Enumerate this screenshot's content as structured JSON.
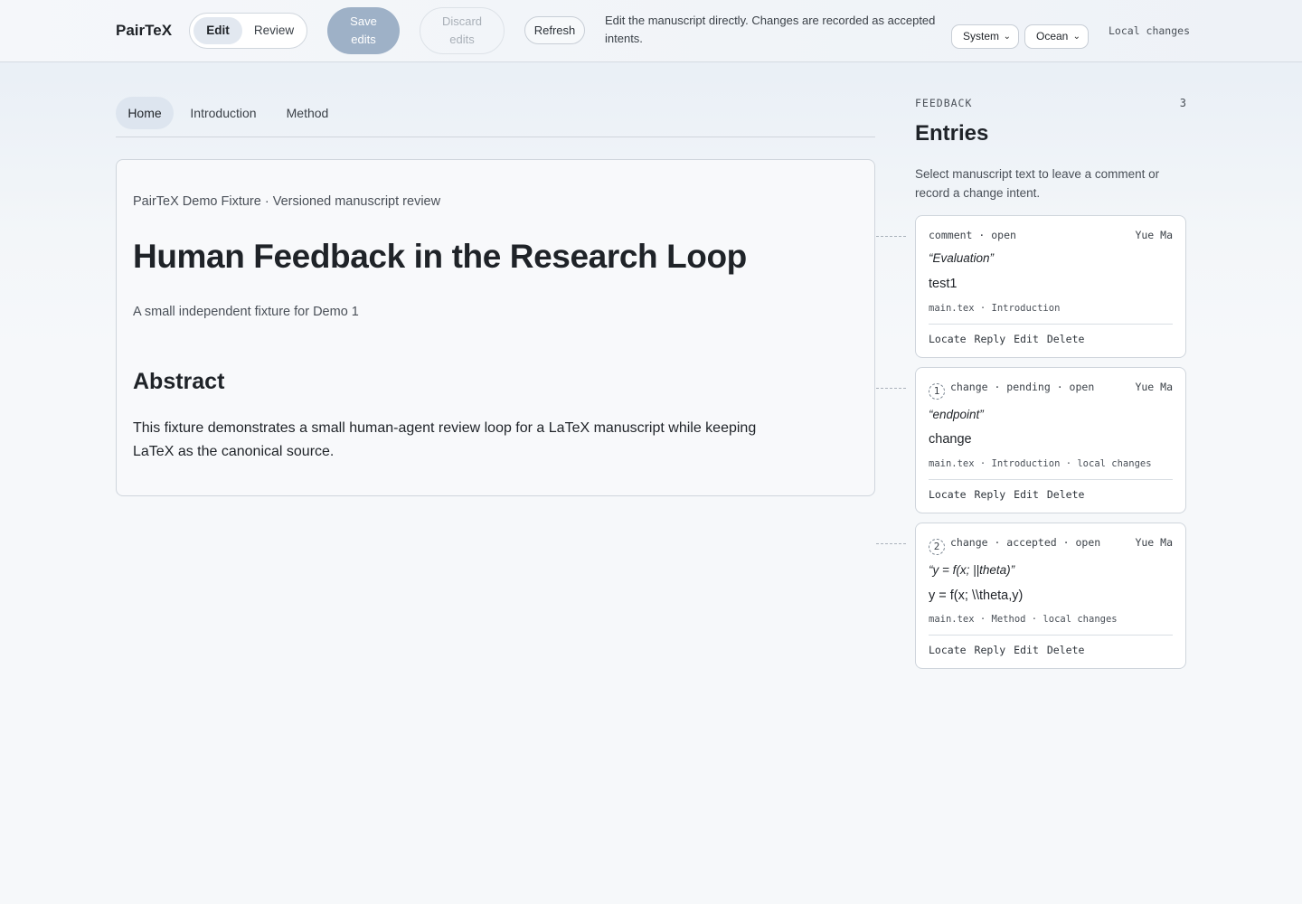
{
  "app": {
    "brand": "PairTeX",
    "mode_edit": "Edit",
    "mode_review": "Review",
    "save_line1": "Save",
    "save_line2": "edits",
    "discard_line1": "Discard",
    "discard_line2": "edits",
    "refresh": "Refresh",
    "hint": "Edit the manuscript directly. Changes are recorded as accepted intents.",
    "theme_select": "System",
    "palette_select": "Ocean",
    "local_changes": "Local changes"
  },
  "tabs": [
    {
      "label": "Home",
      "active": true
    },
    {
      "label": "Introduction",
      "active": false
    },
    {
      "label": "Method",
      "active": false
    }
  ],
  "paper": {
    "meta": "PairTeX Demo Fixture · Versioned manuscript review",
    "title": "Human Feedback in the Research Loop",
    "subtitle": "A small independent fixture for Demo 1",
    "section_heading": "Abstract",
    "abstract": "This fixture demonstrates a small human-agent review loop for a LaTeX manuscript while keeping LaTeX as the canonical source."
  },
  "feedback": {
    "label": "FEEDBACK",
    "count": "3",
    "title": "Entries",
    "description": "Select manuscript text to leave a comment or record a change intent.",
    "entries": [
      {
        "number": "",
        "meta": "comment · open",
        "author": "Yue Ma",
        "quote": "“Evaluation”",
        "text": "test1",
        "location": "main.tex · Introduction",
        "actions": [
          "Locate",
          "Reply",
          "Edit",
          "Delete"
        ]
      },
      {
        "number": "1",
        "meta": "change · pending · open",
        "author": "Yue Ma",
        "quote": "“endpoint”",
        "text": "change",
        "location": "main.tex · Introduction · local changes",
        "actions": [
          "Locate",
          "Reply",
          "Edit",
          "Delete"
        ]
      },
      {
        "number": "2",
        "meta": "change · accepted · open",
        "author": "Yue Ma",
        "quote": "“y = f(x; ||theta)”",
        "text": "y = f(x; \\\\theta,y)",
        "location": "main.tex · Method · local changes",
        "actions": [
          "Locate",
          "Reply",
          "Edit",
          "Delete"
        ]
      }
    ]
  }
}
